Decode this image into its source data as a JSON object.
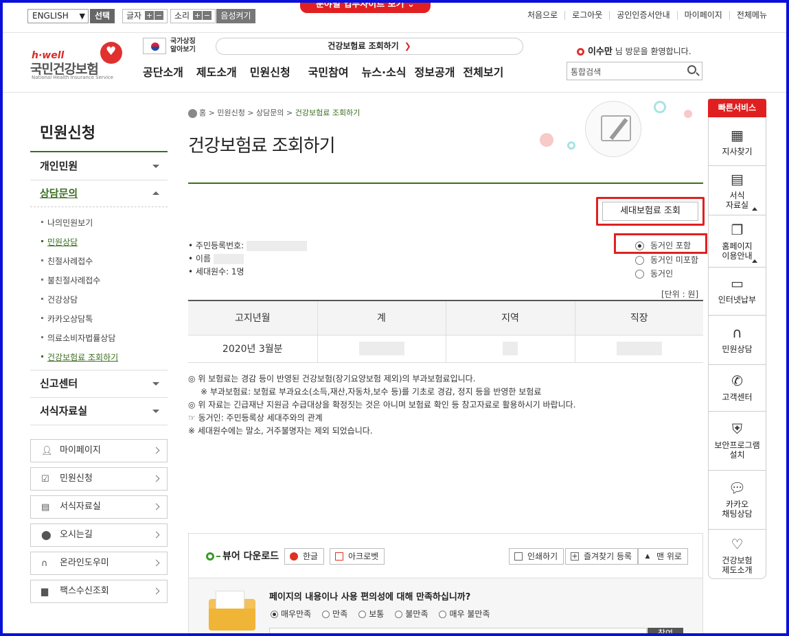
{
  "util": {
    "language": "ENGLISH",
    "select_btn": "선택",
    "font_label": "글자",
    "sound_label": "소리",
    "plus": "+",
    "minus": "−",
    "voice_btn": "음성켜기",
    "field_site": "분야별 업무사이트 보기",
    "links": [
      "처음으로",
      "로그아웃",
      "공인인증서안내",
      "마이페이지",
      "전체메뉴"
    ]
  },
  "header": {
    "logo_small": "h·well",
    "logo_name": "국민건강보험",
    "logo_sub": "National Health Insurance Service",
    "flag_text_1": "국가상징",
    "flag_text_2": "알아보기",
    "promo_search": "건강보험료 조회하기",
    "gnb": [
      "공단소개",
      "제도소개",
      "민원신청",
      "국민참여",
      "뉴스·소식",
      "정보공개",
      "전체보기"
    ],
    "welcome_name": "이수만",
    "welcome_text": "님 방문을 환영합니다.",
    "search_placeholder": "통합검색"
  },
  "lnb": {
    "title": "민원신청",
    "items": [
      "개인민원",
      "상담문의",
      "신고센터",
      "서식자료실"
    ],
    "sub_items": [
      "나의민원보기",
      "민원상담",
      "친절사례접수",
      "불친절사례접수",
      "건강상담",
      "카카오상담톡",
      "의료소비자법률상담",
      "건강보험료 조회하기"
    ],
    "quick_buttons": [
      "마이페이지",
      "민원신청",
      "서식자료실",
      "오시는길",
      "온라인도우미",
      "팩스수신조회"
    ]
  },
  "content": {
    "breadcrumb": [
      "홈",
      "민원신청",
      "상담문의",
      "건강보험료 조회하기"
    ],
    "title": "건강보험료 조회하기",
    "household_btn": "세대보험료 조회",
    "info_rrn": "주민등록번호:",
    "info_name": "이름",
    "info_members": "세대원수: 1명",
    "radio_options": [
      "동거인 포함",
      "동거인 미포함",
      "동거인"
    ],
    "unit": "[단위 : 원]",
    "table_headers": [
      "고지년월",
      "계",
      "지역",
      "직장"
    ],
    "table_row_month": "2020년 3월분",
    "notes": [
      "◎ 위 보험료는 경감 등이 반영된 건강보험(장기요양보험 제외)의 부과보험료입니다.",
      "※ 부과보험료: 보험료 부과요소(소득,재산,자동차,보수 등)를 기초로 경감, 정지 등을 반영한 보험료",
      "◎ 위 자료는 긴급재난 지원금 수급대상을 확정짓는 것은 아니며 보험료 확인 등 참고자료로 활용하시기 바랍니다.",
      "☞ 동거인: 주민등록상 세대주와의 관계",
      "※ 세대원수에는 말소, 거주불명자는 제외 되었습니다."
    ]
  },
  "tools": {
    "viewer_label": "뷰어 다운로드",
    "hangul_btn": "한글",
    "acrobat_btn": "아크로벳",
    "print_btn": "인쇄하기",
    "favorite_btn": "즐겨찾기 등록",
    "top_btn": "맨 위로"
  },
  "survey": {
    "question": "페이지의 내용이나 사용 편의성에 대해 만족하십니까?",
    "options": [
      "매우만족",
      "만족",
      "보통",
      "불만족",
      "매우 불만족"
    ],
    "submit": "참여"
  },
  "quick": {
    "title": "빠른서비스",
    "items": [
      "지사찾기",
      "서식\n자료실",
      "홈페이지\n이용안내",
      "인터넷납부",
      "민원상담",
      "고객센터",
      "보안프로그램\n설치",
      "카카오\n채팅상담",
      "건강보험\n제도소개"
    ]
  },
  "colors": {
    "brand_red": "#e02020",
    "brand_green": "#3a6e1e",
    "frame_blue": "#0a10d8"
  }
}
